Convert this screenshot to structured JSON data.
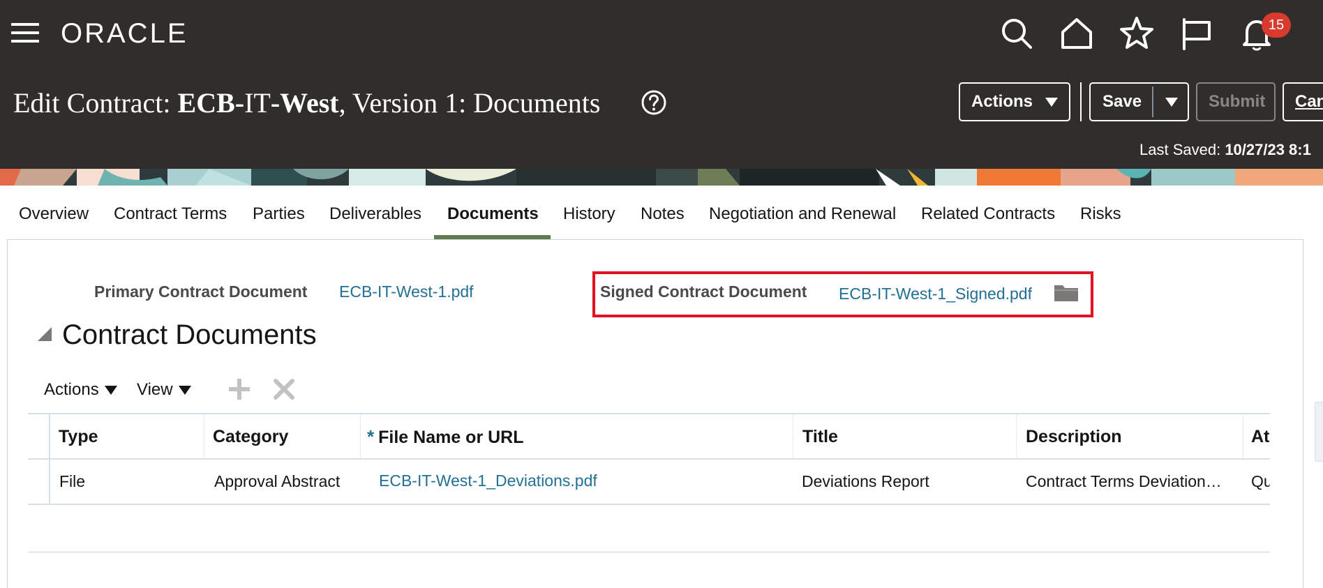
{
  "header": {
    "logo": "ORACLE",
    "title_prefix": "Edit Contract: ",
    "title_contract_a": "ECB-",
    "title_contract_b": "IT",
    "title_contract_c": "-West",
    "title_suffix": ", Version 1: Documents",
    "notification_count": "15",
    "actions_label": "Actions",
    "save_label": "Save",
    "submit_label": "Submit",
    "cancel_label": "Can",
    "last_saved_label": "Last Saved: ",
    "last_saved_value": "10/27/23 8:1"
  },
  "tabs": [
    {
      "label": "Overview"
    },
    {
      "label": "Contract Terms"
    },
    {
      "label": "Parties"
    },
    {
      "label": "Deliverables"
    },
    {
      "label": "Documents"
    },
    {
      "label": "History"
    },
    {
      "label": "Notes"
    },
    {
      "label": "Negotiation and Renewal"
    },
    {
      "label": "Related Contracts"
    },
    {
      "label": "Risks"
    }
  ],
  "documents": {
    "primary_label": "Primary Contract Document",
    "primary_value": "ECB-IT-West-1.pdf",
    "signed_label": "Signed Contract Document",
    "signed_value": "ECB-IT-West-1_Signed.pdf"
  },
  "section": {
    "title": "Contract Documents",
    "toolbar": {
      "actions": "Actions",
      "view": "View"
    }
  },
  "table": {
    "required_mark": "*",
    "columns": [
      "Type",
      "Category",
      "File Name or URL",
      "Title",
      "Description",
      "At"
    ],
    "rows": [
      {
        "type": "File",
        "category": "Approval Abstract",
        "file": "ECB-IT-West-1_Deviations.pdf",
        "title": "Deviations Report",
        "description": "Contract Terms Deviation…",
        "extra": "Qu"
      }
    ]
  },
  "colors": {
    "header_bg": "#312d2a",
    "link": "#227093",
    "active_tab": "#5f7d4f",
    "highlight": "#e0141e",
    "badge": "#d83b2d"
  }
}
